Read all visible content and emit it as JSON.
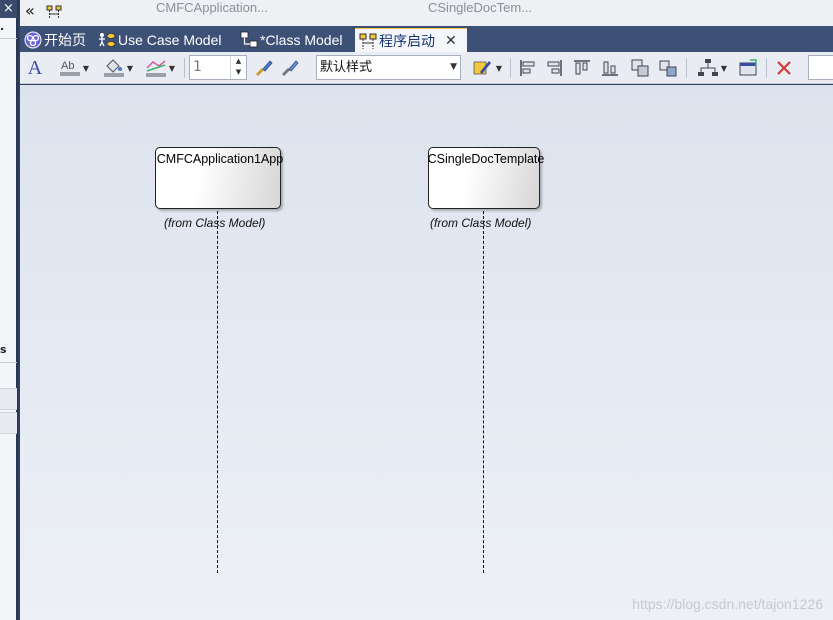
{
  "sidebar": {
    "close_glyph": "×",
    "fragment_text": "s"
  },
  "breadcrumb": {
    "back_glyph": "«",
    "items": [
      "CMFCApplication...",
      "CSingleDocTem..."
    ]
  },
  "tabs": [
    {
      "label": "开始页",
      "icon": "start-page-icon",
      "active": false
    },
    {
      "label": "Use Case Model",
      "icon": "use-case-diagram-icon",
      "active": false
    },
    {
      "label": "*Class Model",
      "icon": "class-diagram-icon",
      "active": false
    },
    {
      "label": "程序启动",
      "icon": "sequence-diagram-icon",
      "active": true,
      "close_glyph": "✕"
    }
  ],
  "toolbar": {
    "line_width_value": "1",
    "style_value": "默认样式",
    "font_glyph": "A"
  },
  "diagram": {
    "lifelines": [
      {
        "name": "CMFCApplication1App",
        "origin": "(from Class Model)"
      },
      {
        "name": "CSingleDocTemplate",
        "origin": "(from Class Model)"
      }
    ],
    "watermark": "https://blog.csdn.net/tajon1226"
  },
  "colors": {
    "tab_bar": "#3d5177",
    "active_tab_text": "#16357a",
    "canvas": "#e4e9f2"
  }
}
